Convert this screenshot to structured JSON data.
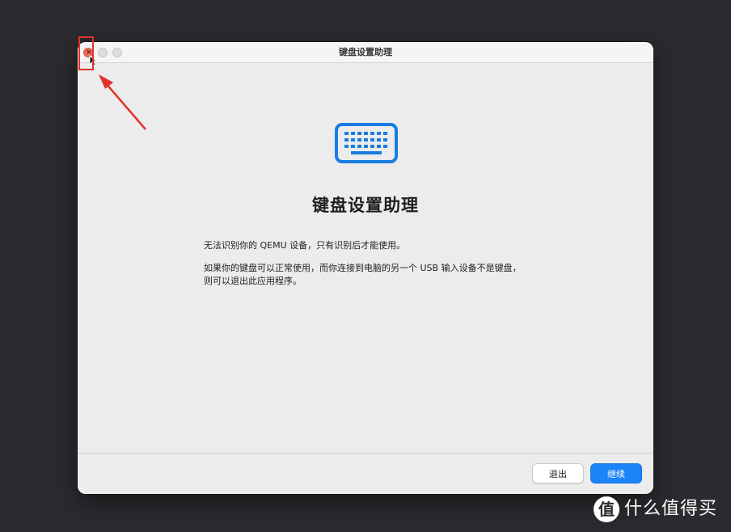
{
  "window": {
    "title": "键盘设置助理",
    "close_glyph": "×"
  },
  "main": {
    "icon": "keyboard-icon",
    "heading": "键盘设置助理",
    "paragraph1": "无法识别你的 QEMU 设备，只有识别后才能使用。",
    "paragraph2_line1": "如果你的键盘可以正常使用，而你连接到电脑的另一个 USB 输入设备不是键盘，",
    "paragraph2_line2": "则可以退出此应用程序。"
  },
  "footer": {
    "quit_label": "退出",
    "continue_label": "继续"
  },
  "annotation": {
    "color": "#e2332b"
  },
  "watermark": {
    "logo_glyph": "值",
    "text": "什么值得买"
  },
  "colors": {
    "accent": "#1a84f8",
    "icon_blue": "#1a7de0",
    "close_red": "#ec6a5e"
  }
}
